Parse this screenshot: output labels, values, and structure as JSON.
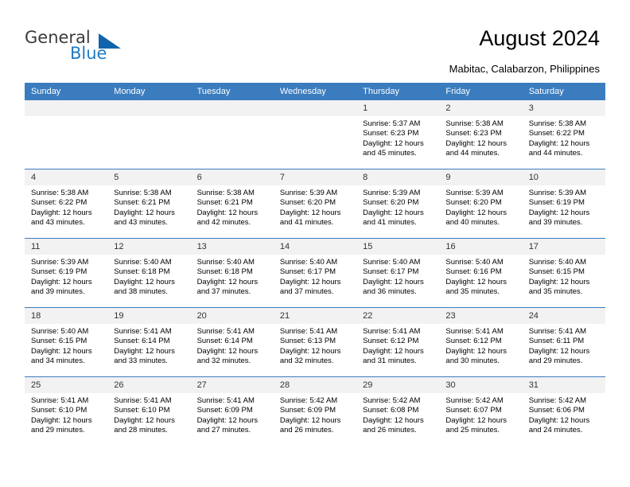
{
  "brand": {
    "name_part1": "General",
    "name_part2": "Blue",
    "accent_color": "#1164ab"
  },
  "header": {
    "title": "August 2024",
    "subtitle": "Mabitac, Calabarzon, Philippines"
  },
  "calendar": {
    "header_bg": "#3a7cbe",
    "daynum_bg": "#f2f2f2",
    "weekdays": [
      "Sunday",
      "Monday",
      "Tuesday",
      "Wednesday",
      "Thursday",
      "Friday",
      "Saturday"
    ],
    "weeks": [
      [
        {
          "day": "",
          "blank": true
        },
        {
          "day": "",
          "blank": true
        },
        {
          "day": "",
          "blank": true
        },
        {
          "day": "",
          "blank": true
        },
        {
          "day": "1",
          "sunrise": "Sunrise: 5:37 AM",
          "sunset": "Sunset: 6:23 PM",
          "daylight": "Daylight: 12 hours and 45 minutes."
        },
        {
          "day": "2",
          "sunrise": "Sunrise: 5:38 AM",
          "sunset": "Sunset: 6:23 PM",
          "daylight": "Daylight: 12 hours and 44 minutes."
        },
        {
          "day": "3",
          "sunrise": "Sunrise: 5:38 AM",
          "sunset": "Sunset: 6:22 PM",
          "daylight": "Daylight: 12 hours and 44 minutes."
        }
      ],
      [
        {
          "day": "4",
          "sunrise": "Sunrise: 5:38 AM",
          "sunset": "Sunset: 6:22 PM",
          "daylight": "Daylight: 12 hours and 43 minutes."
        },
        {
          "day": "5",
          "sunrise": "Sunrise: 5:38 AM",
          "sunset": "Sunset: 6:21 PM",
          "daylight": "Daylight: 12 hours and 43 minutes."
        },
        {
          "day": "6",
          "sunrise": "Sunrise: 5:38 AM",
          "sunset": "Sunset: 6:21 PM",
          "daylight": "Daylight: 12 hours and 42 minutes."
        },
        {
          "day": "7",
          "sunrise": "Sunrise: 5:39 AM",
          "sunset": "Sunset: 6:20 PM",
          "daylight": "Daylight: 12 hours and 41 minutes."
        },
        {
          "day": "8",
          "sunrise": "Sunrise: 5:39 AM",
          "sunset": "Sunset: 6:20 PM",
          "daylight": "Daylight: 12 hours and 41 minutes."
        },
        {
          "day": "9",
          "sunrise": "Sunrise: 5:39 AM",
          "sunset": "Sunset: 6:20 PM",
          "daylight": "Daylight: 12 hours and 40 minutes."
        },
        {
          "day": "10",
          "sunrise": "Sunrise: 5:39 AM",
          "sunset": "Sunset: 6:19 PM",
          "daylight": "Daylight: 12 hours and 39 minutes."
        }
      ],
      [
        {
          "day": "11",
          "sunrise": "Sunrise: 5:39 AM",
          "sunset": "Sunset: 6:19 PM",
          "daylight": "Daylight: 12 hours and 39 minutes."
        },
        {
          "day": "12",
          "sunrise": "Sunrise: 5:40 AM",
          "sunset": "Sunset: 6:18 PM",
          "daylight": "Daylight: 12 hours and 38 minutes."
        },
        {
          "day": "13",
          "sunrise": "Sunrise: 5:40 AM",
          "sunset": "Sunset: 6:18 PM",
          "daylight": "Daylight: 12 hours and 37 minutes."
        },
        {
          "day": "14",
          "sunrise": "Sunrise: 5:40 AM",
          "sunset": "Sunset: 6:17 PM",
          "daylight": "Daylight: 12 hours and 37 minutes."
        },
        {
          "day": "15",
          "sunrise": "Sunrise: 5:40 AM",
          "sunset": "Sunset: 6:17 PM",
          "daylight": "Daylight: 12 hours and 36 minutes."
        },
        {
          "day": "16",
          "sunrise": "Sunrise: 5:40 AM",
          "sunset": "Sunset: 6:16 PM",
          "daylight": "Daylight: 12 hours and 35 minutes."
        },
        {
          "day": "17",
          "sunrise": "Sunrise: 5:40 AM",
          "sunset": "Sunset: 6:15 PM",
          "daylight": "Daylight: 12 hours and 35 minutes."
        }
      ],
      [
        {
          "day": "18",
          "sunrise": "Sunrise: 5:40 AM",
          "sunset": "Sunset: 6:15 PM",
          "daylight": "Daylight: 12 hours and 34 minutes."
        },
        {
          "day": "19",
          "sunrise": "Sunrise: 5:41 AM",
          "sunset": "Sunset: 6:14 PM",
          "daylight": "Daylight: 12 hours and 33 minutes."
        },
        {
          "day": "20",
          "sunrise": "Sunrise: 5:41 AM",
          "sunset": "Sunset: 6:14 PM",
          "daylight": "Daylight: 12 hours and 32 minutes."
        },
        {
          "day": "21",
          "sunrise": "Sunrise: 5:41 AM",
          "sunset": "Sunset: 6:13 PM",
          "daylight": "Daylight: 12 hours and 32 minutes."
        },
        {
          "day": "22",
          "sunrise": "Sunrise: 5:41 AM",
          "sunset": "Sunset: 6:12 PM",
          "daylight": "Daylight: 12 hours and 31 minutes."
        },
        {
          "day": "23",
          "sunrise": "Sunrise: 5:41 AM",
          "sunset": "Sunset: 6:12 PM",
          "daylight": "Daylight: 12 hours and 30 minutes."
        },
        {
          "day": "24",
          "sunrise": "Sunrise: 5:41 AM",
          "sunset": "Sunset: 6:11 PM",
          "daylight": "Daylight: 12 hours and 29 minutes."
        }
      ],
      [
        {
          "day": "25",
          "sunrise": "Sunrise: 5:41 AM",
          "sunset": "Sunset: 6:10 PM",
          "daylight": "Daylight: 12 hours and 29 minutes."
        },
        {
          "day": "26",
          "sunrise": "Sunrise: 5:41 AM",
          "sunset": "Sunset: 6:10 PM",
          "daylight": "Daylight: 12 hours and 28 minutes."
        },
        {
          "day": "27",
          "sunrise": "Sunrise: 5:41 AM",
          "sunset": "Sunset: 6:09 PM",
          "daylight": "Daylight: 12 hours and 27 minutes."
        },
        {
          "day": "28",
          "sunrise": "Sunrise: 5:42 AM",
          "sunset": "Sunset: 6:09 PM",
          "daylight": "Daylight: 12 hours and 26 minutes."
        },
        {
          "day": "29",
          "sunrise": "Sunrise: 5:42 AM",
          "sunset": "Sunset: 6:08 PM",
          "daylight": "Daylight: 12 hours and 26 minutes."
        },
        {
          "day": "30",
          "sunrise": "Sunrise: 5:42 AM",
          "sunset": "Sunset: 6:07 PM",
          "daylight": "Daylight: 12 hours and 25 minutes."
        },
        {
          "day": "31",
          "sunrise": "Sunrise: 5:42 AM",
          "sunset": "Sunset: 6:06 PM",
          "daylight": "Daylight: 12 hours and 24 minutes."
        }
      ]
    ]
  }
}
